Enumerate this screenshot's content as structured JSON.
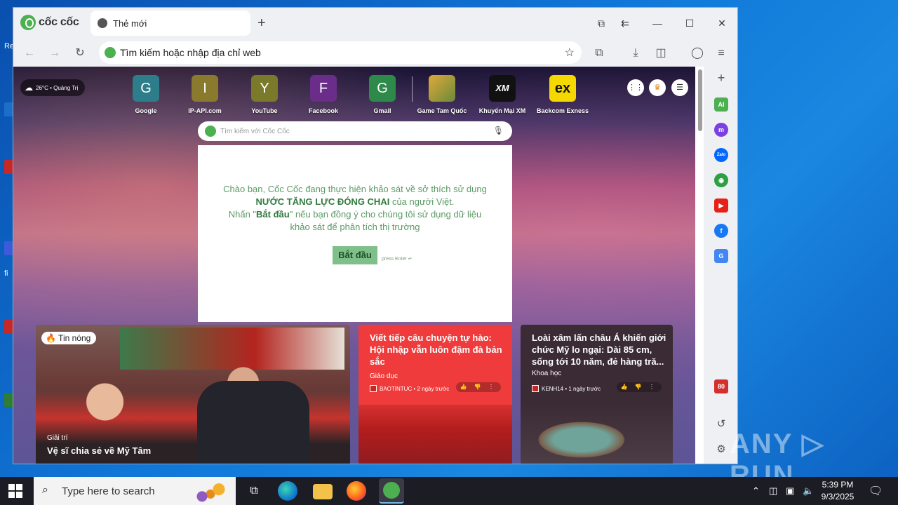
{
  "browser": {
    "brand": "cốc cốc",
    "tab_title": "Thẻ mới",
    "new_tab": "+",
    "address_placeholder": "Tìm kiếm hoặc nhập địa chỉ web"
  },
  "weather": {
    "text": "26°C • Quảng Trị"
  },
  "shortcuts": [
    {
      "letter": "G",
      "label": "Google",
      "color": "#2e7d8a"
    },
    {
      "letter": "I",
      "label": "IP-API.com",
      "color": "#8a7a2e"
    },
    {
      "letter": "Y",
      "label": "YouTube",
      "color": "#7a7a2a"
    },
    {
      "letter": "F",
      "label": "Facebook",
      "color": "#6a2e8a"
    },
    {
      "letter": "G",
      "label": "Gmail",
      "color": "#2e8a4a"
    },
    {
      "letter": "",
      "label": "Game Tam Quốc",
      "color": "#c28a2e"
    },
    {
      "letter": "XM",
      "label": "Khuyến Mại XM",
      "color": "#111111"
    },
    {
      "letter": "ex",
      "label": "Backcom Exness",
      "color": "#f5d800"
    }
  ],
  "search": {
    "placeholder": "Tìm kiếm với Cốc Cốc"
  },
  "survey": {
    "line1": "Chào bạn, Cốc Cốc đang thực hiện khảo sát về sở thích sử dụng",
    "line2_bold": "NƯỚC TĂNG LỰC ĐÓNG CHAI",
    "line2_rest": " của người Việt.",
    "line3_pre": "Nhấn \"",
    "line3_bold": "Bắt đầu",
    "line3_post": "\" nếu bạn đồng ý cho chúng tôi sử dụng dữ liệu",
    "line4": "khảo sát để phân tích thị trường",
    "button": "Bắt đầu",
    "press": "press Enter ↵"
  },
  "news": {
    "hot": {
      "badge": "🔥 Tin nóng",
      "category": "Giải trí",
      "title": "Vệ sĩ chia sẻ về Mỹ Tâm"
    },
    "card2": {
      "title": "Viết tiếp câu chuyện tự hào: Hội nhập vẫn luôn đậm đà bản sắc",
      "category": "Giáo dục",
      "source": "BAOTINTUC • 2 ngày trước",
      "actions": "👍 👎 ⋮"
    },
    "card3": {
      "title": "Loài xâm lấn châu Á khiến giới chức Mỹ lo ngại: Dài 85 cm, sống tới 10 năm, đẻ hàng tră...",
      "category": "Khoa học",
      "source": "KENH14 • 1 ngày trước",
      "actions": "👍 👎 ⋮"
    }
  },
  "sidebar": {
    "items": [
      {
        "label": "+",
        "color": "#eef0f3"
      },
      {
        "label": "AI",
        "color": "#4caf50"
      },
      {
        "label": "m",
        "color": "#7b3fe4"
      },
      {
        "label": "Zalo",
        "color": "#0068ff"
      },
      {
        "label": "◉",
        "color": "#2ea043"
      },
      {
        "label": "▶",
        "color": "#e62117"
      },
      {
        "label": "f",
        "color": "#1877f2"
      },
      {
        "label": "G",
        "color": "#4285f4"
      },
      {
        "label": "80",
        "color": "#d32f2f"
      }
    ]
  },
  "taskbar": {
    "search_placeholder": "Type here to search",
    "time": "5:39 PM",
    "date": "9/3/2025"
  },
  "watermark": "ANY ▷ RUN"
}
